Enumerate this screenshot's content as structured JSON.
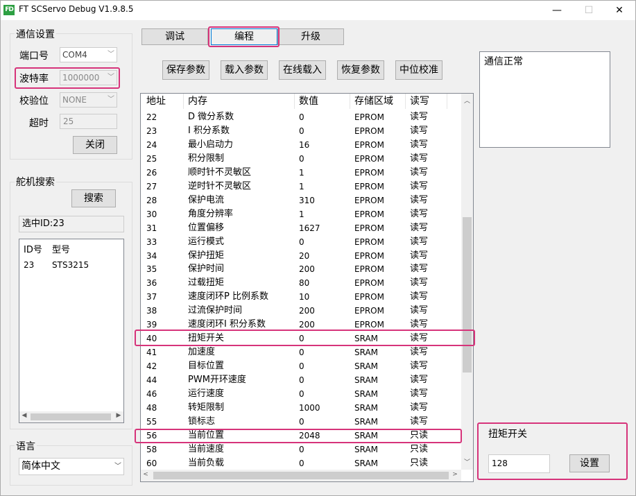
{
  "window": {
    "title": "FT SCServo Debug V1.9.8.5",
    "logo": "FD",
    "min": "—",
    "max": "☐",
    "close": "✕"
  },
  "comm": {
    "group_label": "通信设置",
    "port_label": "端口号",
    "port_value": "COM4",
    "baud_label": "波特率",
    "baud_value": "1000000",
    "parity_label": "校验位",
    "parity_value": "NONE",
    "timeout_label": "超时",
    "timeout_value": "25",
    "close_button": "关闭"
  },
  "search": {
    "group_label": "舵机搜索",
    "search_button": "搜索",
    "selected": "选中ID:23",
    "col_id": "ID号",
    "col_model": "型号",
    "rows": [
      {
        "id": "23",
        "model": "STS3215"
      }
    ]
  },
  "language": {
    "group_label": "语言",
    "value": "简体中文"
  },
  "tabs": [
    {
      "label": "调试"
    },
    {
      "label": "编程"
    },
    {
      "label": "升级"
    }
  ],
  "toolbar": {
    "save": "保存参数",
    "load": "载入参数",
    "online_load": "在线载入",
    "restore": "恢复参数",
    "center": "中位校准"
  },
  "status": {
    "text": "通信正常"
  },
  "table": {
    "headers": {
      "addr": "地址",
      "mem": "内存",
      "value": "数值",
      "area": "存储区域",
      "rw": "读写"
    },
    "rows": [
      {
        "addr": "22",
        "mem": "D 微分系数",
        "value": "0",
        "area": "EPROM",
        "rw": "读写"
      },
      {
        "addr": "23",
        "mem": "I 积分系数",
        "value": "0",
        "area": "EPROM",
        "rw": "读写"
      },
      {
        "addr": "24",
        "mem": "最小启动力",
        "value": "16",
        "area": "EPROM",
        "rw": "读写"
      },
      {
        "addr": "25",
        "mem": "积分限制",
        "value": "0",
        "area": "EPROM",
        "rw": "读写"
      },
      {
        "addr": "26",
        "mem": "顺时针不灵敏区",
        "value": "1",
        "area": "EPROM",
        "rw": "读写"
      },
      {
        "addr": "27",
        "mem": "逆时针不灵敏区",
        "value": "1",
        "area": "EPROM",
        "rw": "读写"
      },
      {
        "addr": "28",
        "mem": "保护电流",
        "value": "310",
        "area": "EPROM",
        "rw": "读写"
      },
      {
        "addr": "30",
        "mem": "角度分辨率",
        "value": "1",
        "area": "EPROM",
        "rw": "读写"
      },
      {
        "addr": "31",
        "mem": "位置偏移",
        "value": "1627",
        "area": "EPROM",
        "rw": "读写"
      },
      {
        "addr": "33",
        "mem": "运行模式",
        "value": "0",
        "area": "EPROM",
        "rw": "读写"
      },
      {
        "addr": "34",
        "mem": "保护扭矩",
        "value": "20",
        "area": "EPROM",
        "rw": "读写"
      },
      {
        "addr": "35",
        "mem": "保护时间",
        "value": "200",
        "area": "EPROM",
        "rw": "读写"
      },
      {
        "addr": "36",
        "mem": "过载扭矩",
        "value": "80",
        "area": "EPROM",
        "rw": "读写"
      },
      {
        "addr": "37",
        "mem": "速度闭环P 比例系数",
        "value": "10",
        "area": "EPROM",
        "rw": "读写"
      },
      {
        "addr": "38",
        "mem": "过流保护时间",
        "value": "200",
        "area": "EPROM",
        "rw": "读写"
      },
      {
        "addr": "39",
        "mem": "速度闭环I 积分系数",
        "value": "200",
        "area": "EPROM",
        "rw": "读写"
      },
      {
        "addr": "40",
        "mem": "扭矩开关",
        "value": "0",
        "area": "SRAM",
        "rw": "读写"
      },
      {
        "addr": "41",
        "mem": "加速度",
        "value": "0",
        "area": "SRAM",
        "rw": "读写"
      },
      {
        "addr": "42",
        "mem": "目标位置",
        "value": "0",
        "area": "SRAM",
        "rw": "读写"
      },
      {
        "addr": "44",
        "mem": "PWM开环速度",
        "value": "0",
        "area": "SRAM",
        "rw": "读写"
      },
      {
        "addr": "46",
        "mem": "运行速度",
        "value": "0",
        "area": "SRAM",
        "rw": "读写"
      },
      {
        "addr": "48",
        "mem": "转矩限制",
        "value": "1000",
        "area": "SRAM",
        "rw": "读写"
      },
      {
        "addr": "55",
        "mem": "锁标志",
        "value": "0",
        "area": "SRAM",
        "rw": "读写"
      },
      {
        "addr": "56",
        "mem": "当前位置",
        "value": "2048",
        "area": "SRAM",
        "rw": "只读"
      },
      {
        "addr": "58",
        "mem": "当前速度",
        "value": "0",
        "area": "SRAM",
        "rw": "只读"
      },
      {
        "addr": "60",
        "mem": "当前负载",
        "value": "0",
        "area": "SRAM",
        "rw": "只读"
      }
    ]
  },
  "torque": {
    "label": "扭矩开关",
    "value": "128",
    "set_button": "设置"
  },
  "colors": {
    "highlight": "#d6337a"
  }
}
